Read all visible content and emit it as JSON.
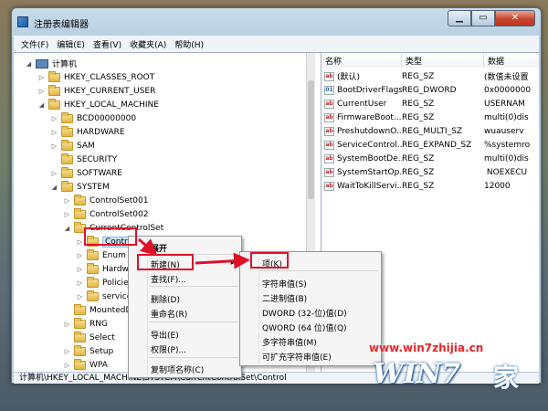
{
  "window": {
    "title": "注册表编辑器"
  },
  "menubar": [
    "文件(F)",
    "编辑(E)",
    "查看(V)",
    "收藏夹(A)",
    "帮助(H)"
  ],
  "tree": [
    {
      "label": "计算机",
      "icon": "computer",
      "expander": "◢"
    },
    {
      "label": "HKEY_CLASSES_ROOT",
      "expander": "▷"
    },
    {
      "label": "HKEY_CURRENT_USER",
      "expander": "▷"
    },
    {
      "label": "HKEY_LOCAL_MACHINE",
      "expander": "◢"
    },
    {
      "label": "BCD00000000",
      "expander": "▷"
    },
    {
      "label": "HARDWARE",
      "expander": "▷"
    },
    {
      "label": "SAM",
      "expander": "▷"
    },
    {
      "label": "SECURITY",
      "expander": ""
    },
    {
      "label": "SOFTWARE",
      "expander": "▷"
    },
    {
      "label": "SYSTEM",
      "expander": "◢"
    },
    {
      "label": "ControlSet001",
      "expander": "▷"
    },
    {
      "label": "ControlSet002",
      "expander": "▷"
    },
    {
      "label": "CurrentControlSet",
      "expander": "◢"
    },
    {
      "label": "Control",
      "expander": "▷"
    },
    {
      "label": "Enum",
      "expander": "▷"
    },
    {
      "label": "Hardw",
      "expander": "▷"
    },
    {
      "label": "Policies",
      "expander": "▷"
    },
    {
      "label": "service",
      "expander": "▷"
    },
    {
      "label": "MountedD",
      "expander": ""
    },
    {
      "label": "RNG",
      "expander": "▷"
    },
    {
      "label": "Select",
      "expander": ""
    },
    {
      "label": "Setup",
      "expander": "▷"
    },
    {
      "label": "WPA",
      "expander": "▷"
    }
  ],
  "columns": [
    "名称",
    "类型",
    "数据"
  ],
  "values": [
    {
      "name": "(默认)",
      "type": "REG_SZ",
      "data": "(数值未设置",
      "icon": "ab"
    },
    {
      "name": "BootDriverFlags",
      "type": "REG_DWORD",
      "data": "0x0000000",
      "icon": "bin"
    },
    {
      "name": "CurrentUser",
      "type": "REG_SZ",
      "data": "USERNAM",
      "icon": "ab"
    },
    {
      "name": "FirmwareBoot...",
      "type": "REG_SZ",
      "data": "multi(0)dis",
      "icon": "ab"
    },
    {
      "name": "PreshutdownO...",
      "type": "REG_MULTI_SZ",
      "data": "wuauserv",
      "icon": "ab"
    },
    {
      "name": "ServiceControl...",
      "type": "REG_EXPAND_SZ",
      "data": "%systemro",
      "icon": "ab"
    },
    {
      "name": "SystemBootDe...",
      "type": "REG_SZ",
      "data": "multi(0)dis",
      "icon": "ab"
    },
    {
      "name": "SystemStartOp...",
      "type": "REG_SZ",
      "data": " NOEXECU",
      "icon": "ab"
    },
    {
      "name": "WaitToKillServi...",
      "type": "REG_SZ",
      "data": "12000",
      "icon": "ab"
    }
  ],
  "context_menu": {
    "items": [
      "展开",
      "新建(N)",
      "查找(F)...",
      "删除(D)",
      "重命名(R)",
      "导出(E)",
      "权限(P)...",
      "复制项名称(C)"
    ]
  },
  "submenu": {
    "items": [
      "项(K)",
      "字符串值(S)",
      "二进制值(B)",
      "DWORD (32-位)值(D)",
      "QWORD (64 位)值(Q)",
      "多字符串值(M)",
      "可扩充字符串值(E)"
    ]
  },
  "statusbar": {
    "path": "计算机\\HKEY_LOCAL_MACHINE\\SYSTEM\\CurrentControlSet\\Control"
  },
  "watermark": {
    "domain": "www.win7zhijia.cn",
    "logo": "WIN7",
    "logo_suffix": "家"
  },
  "colors": {
    "highlight_box": "#e0102a",
    "selection": "#cde6f7"
  }
}
